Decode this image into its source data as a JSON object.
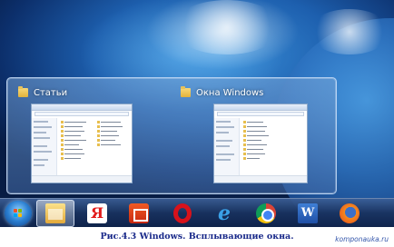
{
  "thumbnails": [
    {
      "title": "Статьи",
      "icon": "folder-icon"
    },
    {
      "title": "Окна Windows",
      "icon": "folder-icon"
    }
  ],
  "taskbar": {
    "start": {
      "icon": "windows-start-icon"
    },
    "buttons": [
      {
        "name": "explorer",
        "icon": "explorer-folder-icon",
        "active": true
      },
      {
        "name": "yandex",
        "icon": "yandex-browser-icon",
        "label": "Я",
        "active": false
      },
      {
        "name": "office",
        "icon": "office-icon",
        "active": false
      },
      {
        "name": "opera",
        "icon": "opera-icon",
        "active": false
      },
      {
        "name": "internet-explorer",
        "icon": "internet-explorer-icon",
        "label": "e",
        "active": false
      },
      {
        "name": "chrome",
        "icon": "chrome-icon",
        "active": false
      },
      {
        "name": "word",
        "icon": "word-icon",
        "label": "W",
        "active": false
      },
      {
        "name": "firefox",
        "icon": "firefox-icon",
        "active": false
      }
    ]
  },
  "caption": "Рис.4.3 Windows. Всплывающие окна.",
  "watermark": "komponauka.ru",
  "colors": {
    "caption": "#1a2a8a",
    "taskbar": "#1e3a6e",
    "desktop": "#1d5fae"
  }
}
